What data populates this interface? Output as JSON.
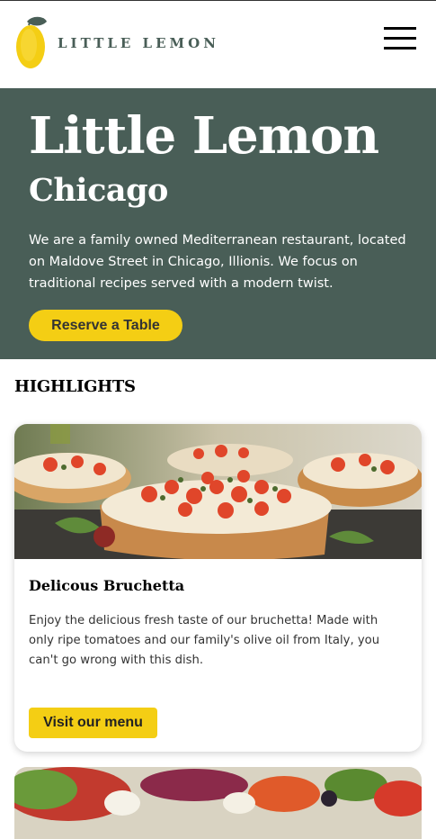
{
  "header": {
    "logo_text": "LITTLE LEMON",
    "logo_icon": "lemon-icon",
    "menu_icon": "hamburger-menu-icon"
  },
  "hero": {
    "title": "Little Lemon",
    "subtitle": "Chicago",
    "description": "We are a family owned Mediterranean restaurant, located on Maldove Street in Chicago, Illionis. We focus on traditional recipes served with a modern twist.",
    "reserve_label": "Reserve a Table"
  },
  "highlights": {
    "heading": "HIGHLIGHTS",
    "cards": [
      {
        "title": "Delicous Bruchetta",
        "description": "Enjoy the delicious fresh taste of our bruchetta! Made with only ripe tomatoes and our family's olive oil from Italy, you can't go wrong with this dish.",
        "button_label": "Visit our menu",
        "image": "bruschetta-photo"
      },
      {
        "image": "greek-salad-photo"
      }
    ]
  },
  "colors": {
    "primary_green": "#495e57",
    "primary_yellow": "#f4ce14",
    "text_dark": "#333333"
  }
}
